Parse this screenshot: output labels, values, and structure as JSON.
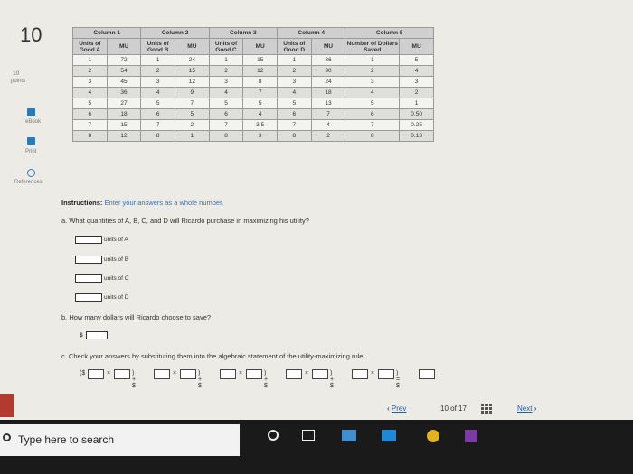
{
  "question_number": "10",
  "sidebar": {
    "points_value": "10",
    "points_label": "points",
    "ebook_label": "eBook",
    "print_label": "Print",
    "references_label": "References"
  },
  "table": {
    "column_titles": [
      "Column 1",
      "Column 2",
      "Column 3",
      "Column 4",
      "Column 5"
    ],
    "sub_headers": [
      "Units of Good A",
      "MU",
      "Units of Good B",
      "MU",
      "Units of Good C",
      "MU",
      "Units of Good D",
      "MU",
      "Number of Dollars Saved",
      "MU"
    ],
    "rows": [
      [
        "1",
        "72",
        "1",
        "24",
        "1",
        "15",
        "1",
        "36",
        "1",
        "5"
      ],
      [
        "2",
        "54",
        "2",
        "15",
        "2",
        "12",
        "2",
        "30",
        "2",
        "4"
      ],
      [
        "3",
        "45",
        "3",
        "12",
        "3",
        "8",
        "3",
        "24",
        "3",
        "3"
      ],
      [
        "4",
        "36",
        "4",
        "9",
        "4",
        "7",
        "4",
        "18",
        "4",
        "2"
      ],
      [
        "5",
        "27",
        "5",
        "7",
        "5",
        "5",
        "5",
        "13",
        "5",
        "1"
      ],
      [
        "6",
        "18",
        "6",
        "5",
        "6",
        "4",
        "6",
        "7",
        "6",
        "0.50"
      ],
      [
        "7",
        "15",
        "7",
        "2",
        "7",
        "3.5",
        "7",
        "4",
        "7",
        "0.25"
      ],
      [
        "8",
        "12",
        "8",
        "1",
        "8",
        "3",
        "8",
        "2",
        "8",
        "0.13"
      ]
    ]
  },
  "instructions": {
    "lead": "Instructions:",
    "rest": "Enter your answers as a whole number."
  },
  "part_a": {
    "question": "a. What quantities of A, B, C, and D will Ricardo purchase in maximizing his utility?",
    "labels": [
      "units of A",
      "units of B",
      "units of C",
      "units of D"
    ]
  },
  "part_b": {
    "question": "b. How many dollars will Ricardo choose to save?",
    "currency": "$"
  },
  "part_c": {
    "question": "c. Check your answers by substituting them into the algebraic statement of the utility-maximizing rule.",
    "eq_open": "($",
    "eq_times": "×",
    "eq_plus_dollar": ") + $",
    "eq_end": ") = $"
  },
  "navigation": {
    "prev_label": "Prev",
    "page_current": "10",
    "page_of": "of",
    "page_total": "17",
    "next_label": "Next"
  },
  "taskbar": {
    "search_placeholder": "Type here to search"
  },
  "colors": {
    "link_blue": "#1b5fa8",
    "instructions_blue": "#3a6fb5",
    "brand_red": "#b23a2e"
  }
}
